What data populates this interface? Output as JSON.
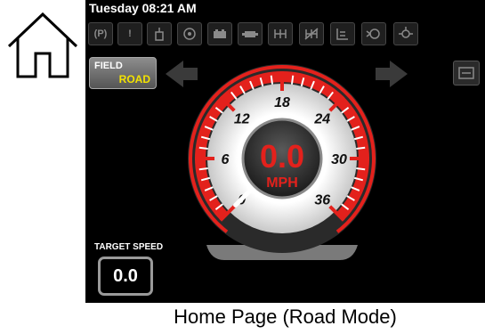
{
  "header": {
    "datetime": "Tuesday 08:21 AM"
  },
  "toolbar": {
    "icons": [
      {
        "name": "parking-brake-icon",
        "glyph": "(P)"
      },
      {
        "name": "warning-icon",
        "glyph": "!"
      },
      {
        "name": "fuel-filter-icon",
        "glyph": ""
      },
      {
        "name": "engine-oil-pressure-icon",
        "glyph": ""
      },
      {
        "name": "battery-icon",
        "glyph": ""
      },
      {
        "name": "engine-icon",
        "glyph": ""
      },
      {
        "name": "transmission-icon",
        "glyph": ""
      },
      {
        "name": "transmission-fault-icon",
        "glyph": ""
      },
      {
        "name": "hydraulic-level-icon",
        "glyph": ""
      },
      {
        "name": "pump-icon",
        "glyph": ""
      },
      {
        "name": "filter-icon",
        "glyph": ""
      }
    ]
  },
  "mode": {
    "line1": "FIELD",
    "line2": "ROAD",
    "road_color": "#f3e200"
  },
  "gauge": {
    "value": "0.0",
    "unit": "MPH",
    "current_speed": 0,
    "min": 0,
    "max": 36,
    "tick_labels": [
      "0",
      "6",
      "12",
      "18",
      "24",
      "30",
      "36"
    ],
    "accent": "#e3211c"
  },
  "target": {
    "label": "TARGET SPEED",
    "value": "0.0"
  },
  "caption": "Home Page (Road Mode)"
}
